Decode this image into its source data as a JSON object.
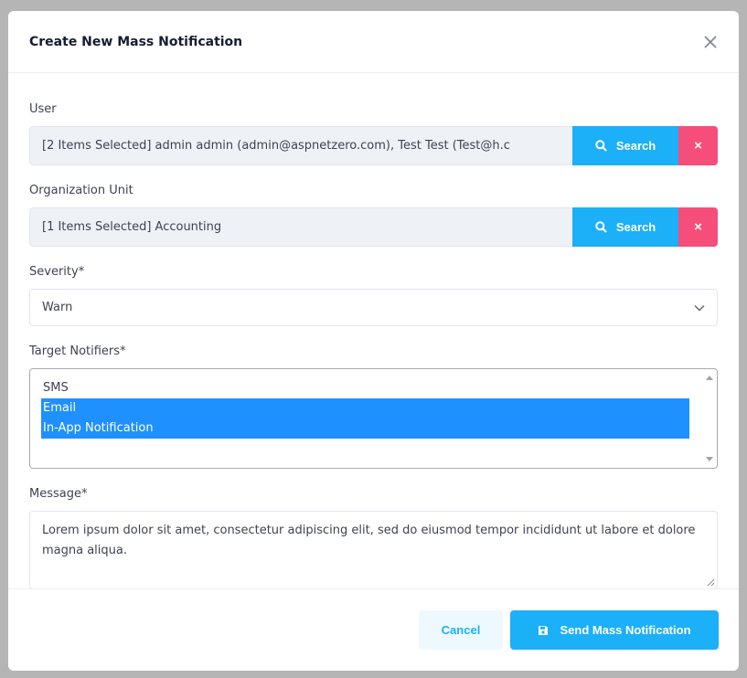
{
  "modal": {
    "title": "Create New Mass Notification"
  },
  "form": {
    "user": {
      "label": "User",
      "value": "[2 Items Selected] admin admin (admin@aspnetzero.com), Test Test (Test@h.c",
      "search_label": "Search",
      "clear_label": "×"
    },
    "org_unit": {
      "label": "Organization Unit",
      "value": "[1 Items Selected] Accounting",
      "search_label": "Search",
      "clear_label": "×"
    },
    "severity": {
      "label": "Severity*",
      "value": "Warn"
    },
    "target_notifiers": {
      "label": "Target Notifiers*",
      "options": [
        {
          "label": "SMS",
          "selected": false
        },
        {
          "label": "Email",
          "selected": true
        },
        {
          "label": "In-App Notification",
          "selected": true
        }
      ]
    },
    "message": {
      "label": "Message*",
      "value": "Lorem ipsum dolor sit amet, consectetur adipiscing elit, sed do eiusmod tempor incididunt ut labore et dolore magna aliqua."
    }
  },
  "footer": {
    "cancel_label": "Cancel",
    "send_label": "Send Mass Notification"
  },
  "icons": {
    "close": "close-icon",
    "search": "search-icon",
    "chevron": "chevron-down-icon",
    "save": "save-icon"
  },
  "colors": {
    "primary": "#1bb0f7",
    "danger": "#f64e7a",
    "selected_option": "#1e90ff"
  }
}
